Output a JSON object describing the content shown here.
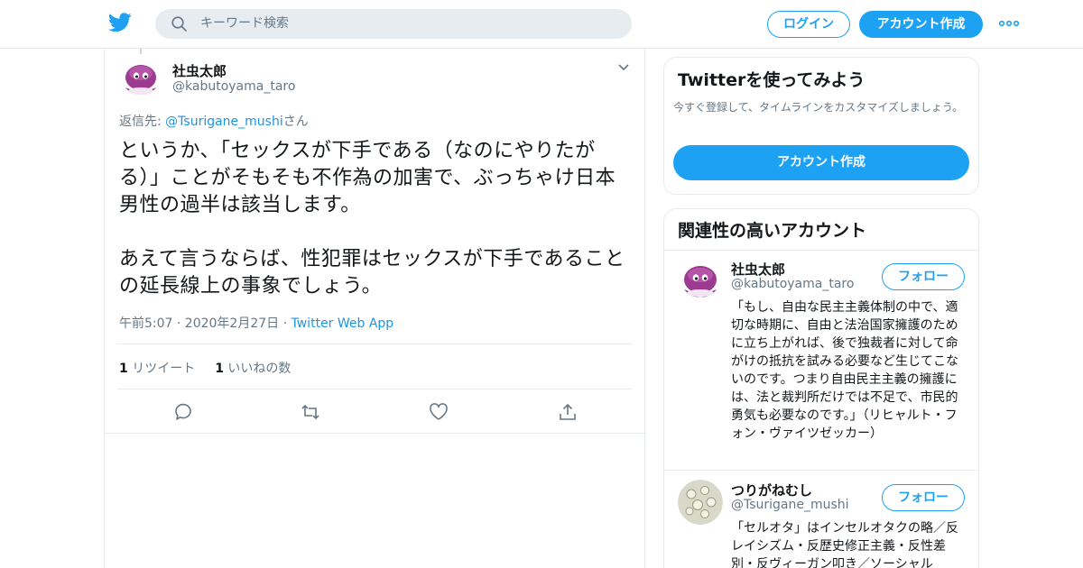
{
  "header": {
    "search_placeholder": "キーワード検索",
    "login_label": "ログイン",
    "signup_label": "アカウント作成",
    "brand_color": "#1da1f2"
  },
  "tweet": {
    "author_name": "社虫太郎",
    "author_handle": "@kabutoyama_taro",
    "reply_prefix": "返信先: ",
    "reply_mention": "@Tsurigane_mushi",
    "reply_suffix": "さん",
    "text": "というか、「セックスが下手である（なのにやりたがる）」ことがそもそも不作為の加害で、ぶっちゃけ日本男性の過半は該当します。\n\nあえて言うならば、性犯罪はセックスが下手であることの延長線上の事象でしょう。",
    "timestamp": "午前5:07 · 2020年2月27日 · ",
    "source_app": "Twitter Web App",
    "retweet_count": "1",
    "retweet_label": "リツイート",
    "like_count": "1",
    "like_label": "いいねの数"
  },
  "signup_card": {
    "title": "Twitterを使ってみよう",
    "description": "今すぐ登録して、タイムラインをカスタマイズしましょう。",
    "cta_label": "アカウント作成"
  },
  "related": {
    "title": "関連性の高いアカウント",
    "accounts": [
      {
        "name": "社虫太郎",
        "handle": "@kabutoyama_taro",
        "follow_label": "フォロー",
        "bio": "「もし、自由な民主主義体制の中で、適切な時期に、自由と法治国家擁護のために立ち上がれば、後で独裁者に対して命がけの抵抗を試みる必要など生じてこないのです。つまり自由民主主義の擁護には、法と裁判所だけでは不足で、市民的勇気も必要なのです。」（リヒャルト・フォン・ヴァイツゼッカー）"
      },
      {
        "name": "つりがねむし",
        "handle": "@Tsurigane_mushi",
        "follow_label": "フォロー",
        "bio": "「セルオタ」はインセルオタクの略／反レイシズム・反歴史修正主義・反性差別・反ヴィーガン叩き／ソーシャル"
      }
    ]
  }
}
